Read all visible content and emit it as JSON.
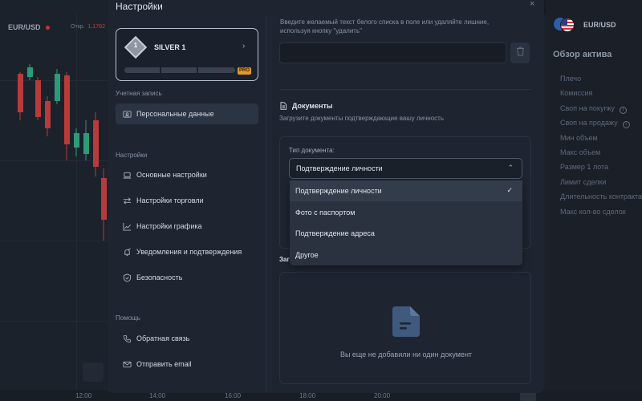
{
  "background": {
    "pair": "EUR/USD",
    "open_label": "Откр.",
    "open_value": "1.1782",
    "time_ticks": [
      "12:00",
      "14:00",
      "16:00",
      "18:00",
      "20:00"
    ],
    "asset_pair": "EUR/USD",
    "overview_title": "Обзор актива",
    "asset_fields": [
      "Плечо",
      "Комиссия",
      "Своп на покупку",
      "Своп на продажу",
      "Мин объем",
      "Макс объем",
      "Размер 1 лота",
      "Лимит сделки",
      "Длительность контракта",
      "Макс кол-во сделок"
    ]
  },
  "modal": {
    "title": "Настройки",
    "close_glyph": "×",
    "profile": {
      "level_number": "1",
      "level_name": "SILVER 1",
      "chevron": "›",
      "pro_badge": "PRO",
      "progress": 0
    },
    "sections": {
      "account": "Учетная запись",
      "settings": "Настройки",
      "help": "Помощь"
    },
    "nav": {
      "personal": "Персональные данные",
      "general": "Основные настройки",
      "trading": "Настройки торговли",
      "chart": "Настройки графика",
      "notifications": "Уведомления и подтверждения",
      "security": "Безопасность",
      "feedback": "Обратная связь",
      "email": "Отправить email"
    },
    "whitelist": {
      "text": "Введите желаемый текст белого списка в поле или удаляйте лишние, используя кнопку \"удалить\"",
      "value": ""
    },
    "documents": {
      "title": "Документы",
      "subtitle": "Загрузите документы подтверждающие вашу личность",
      "type_label": "Тип документа:",
      "selected": "Подтверждение личности",
      "options": [
        "Подтверждение личности",
        "Фото с паспортом",
        "Подтверждение адреса",
        "Другое"
      ],
      "check_glyph": "✓",
      "chevron_up": "⌃",
      "uploaded_label": "Загруженные документы",
      "empty_text": "Вы еще не добавили ни один документ"
    }
  }
}
